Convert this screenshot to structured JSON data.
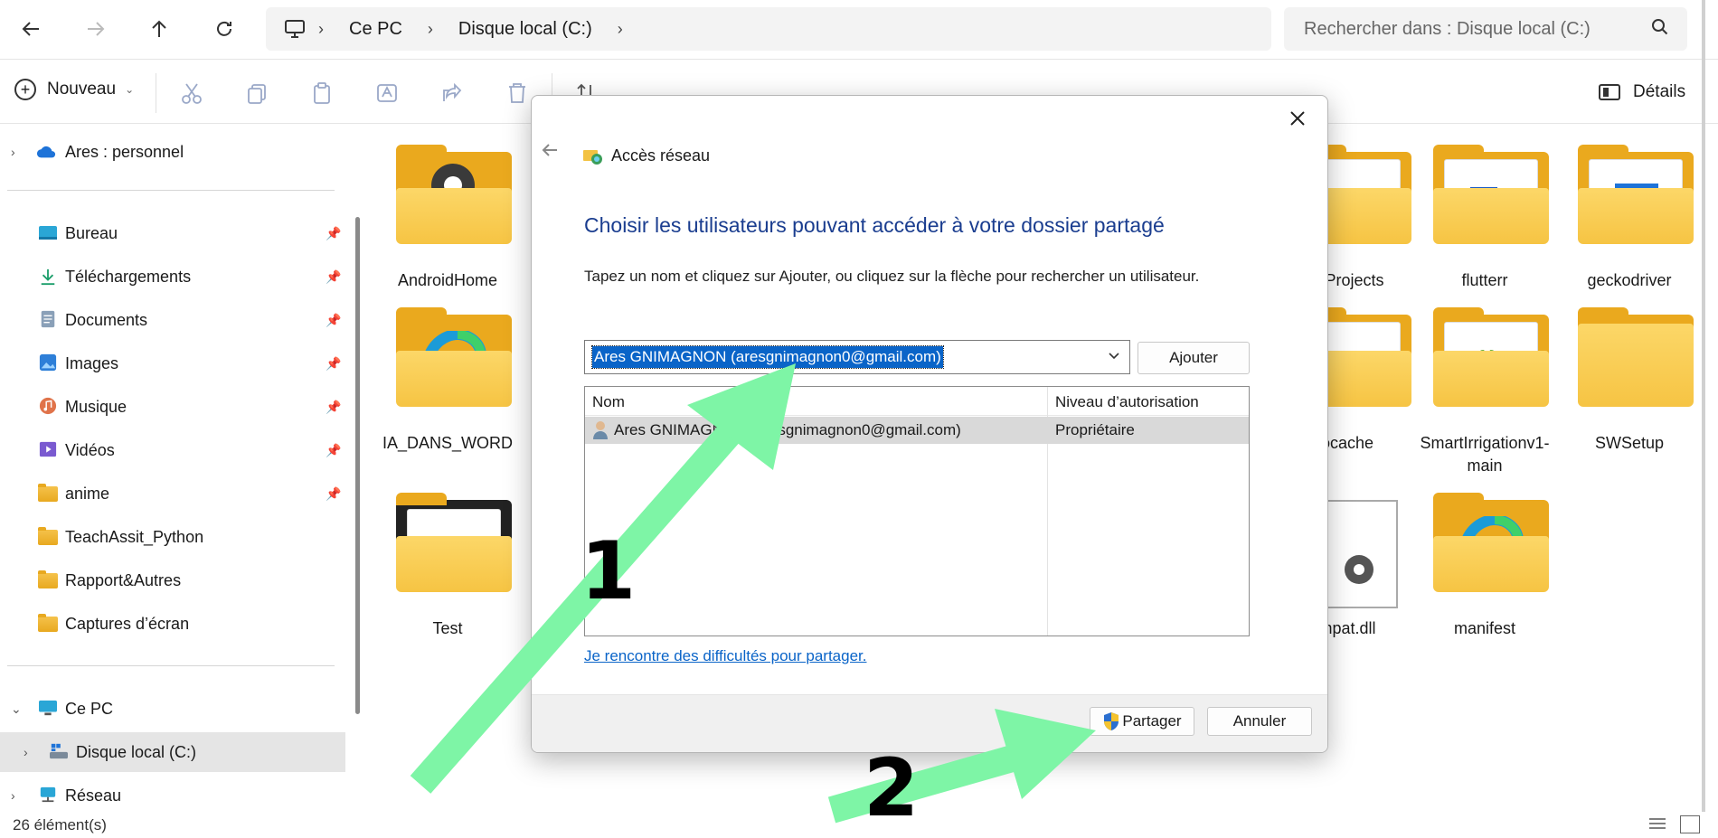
{
  "nav": {
    "back_icon": "arrow-left-icon",
    "forward_icon": "arrow-right-icon",
    "up_icon": "arrow-up-icon",
    "refresh_icon": "refresh-icon"
  },
  "address": {
    "segments": [
      "Ce PC",
      "Disque local (C:)"
    ]
  },
  "search": {
    "placeholder": "Rechercher dans : Disque local (C:)"
  },
  "toolbar": {
    "new_label": "Nouveau",
    "details_label": "Détails"
  },
  "sidebar": {
    "onedrive": "Ares : personnel",
    "quick": [
      "Bureau",
      "Téléchargements",
      "Documents",
      "Images",
      "Musique",
      "Vidéos",
      "anime",
      "TeachAssit_Python",
      "Rapport&Autres",
      "Captures d’écran"
    ],
    "this_pc": "Ce PC",
    "local_disk": "Disque local (C:)",
    "network": "Réseau"
  },
  "content": {
    "tiles": [
      "AndroidHome",
      "IA_DANS_WORD",
      "Test",
      "erProjects",
      "ocache",
      "mpat.dll",
      "flutterr",
      "SmartIrrigationv1-main",
      "manifest",
      "geckodriver",
      "SWSetup"
    ]
  },
  "status": {
    "count": "26 élément(s)"
  },
  "dialog": {
    "title": "Accès réseau",
    "heading": "Choisir les utilisateurs pouvant accéder à votre dossier partagé",
    "description": "Tapez un nom et cliquez sur Ajouter, ou cliquez sur la flèche pour rechercher un utilisateur.",
    "input_value": "Ares GNIMAGNON (aresgnimagnon0@gmail.com)",
    "add_label": "Ajouter",
    "col_name": "Nom",
    "col_level": "Niveau d’autorisation",
    "user_name": "Ares GNIMAGNON (aresgnimagnon0@gmail.com)",
    "user_level": "Propriétaire",
    "help_link": "Je rencontre des difficultés pour partager.",
    "share_label": "Partager",
    "cancel_label": "Annuler"
  },
  "annotations": {
    "step1": "1",
    "step2": "2",
    "arrow_color": "#7ef5a6"
  }
}
